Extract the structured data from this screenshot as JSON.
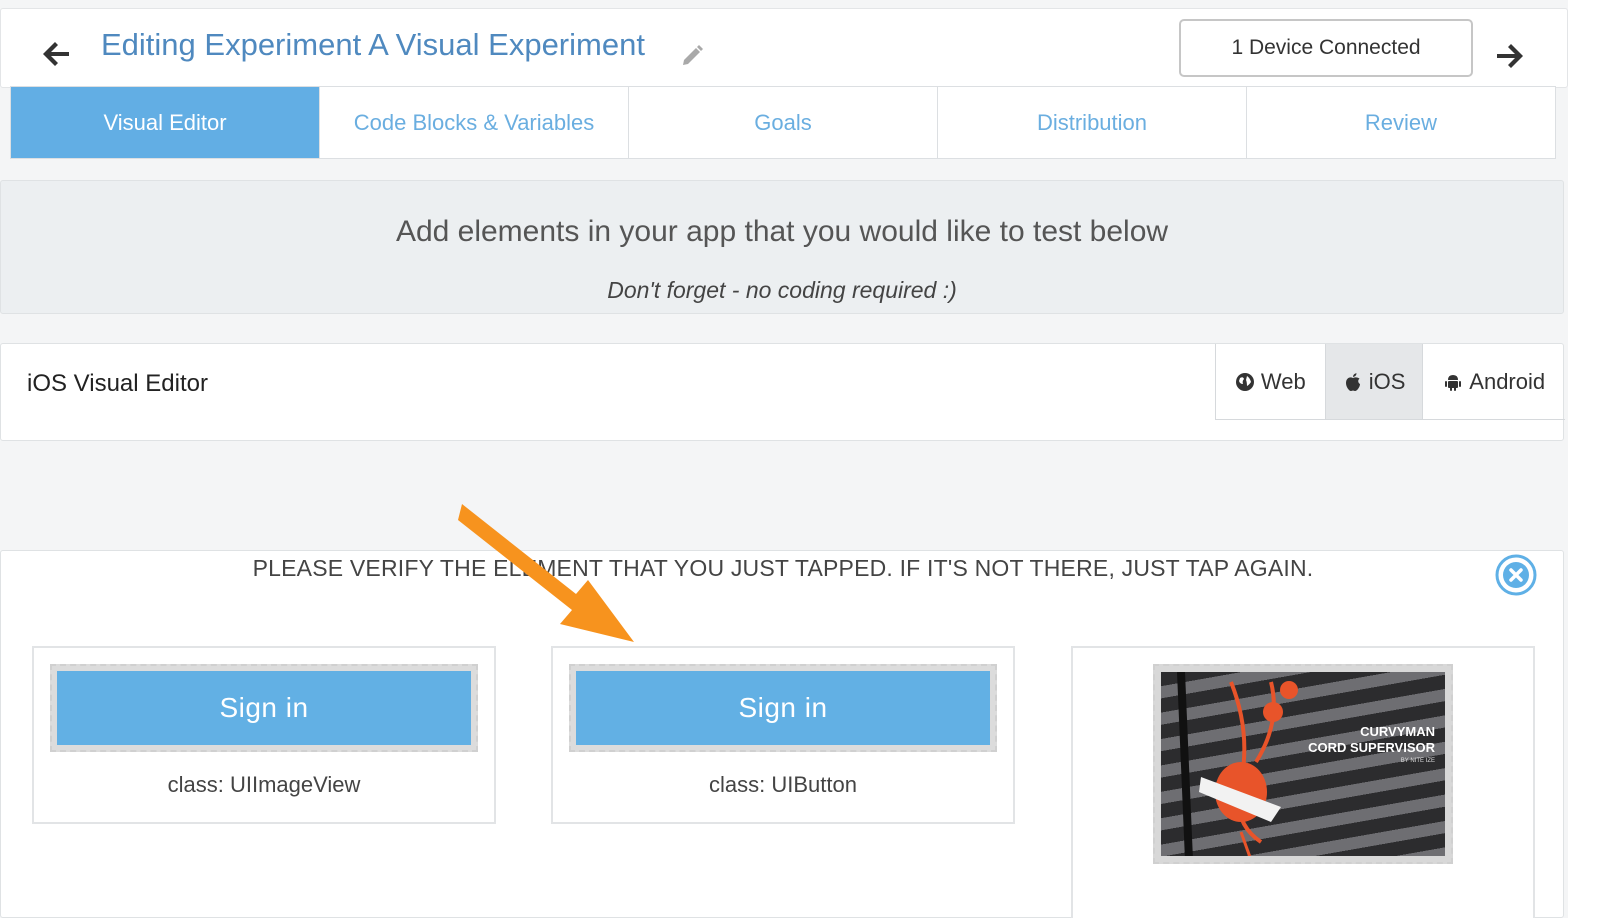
{
  "header": {
    "title": "Editing Experiment A Visual Experiment",
    "device_status": "1 Device Connected"
  },
  "tabs": [
    {
      "label": "Visual Editor",
      "active": true
    },
    {
      "label": "Code Blocks & Variables",
      "active": false
    },
    {
      "label": "Goals",
      "active": false
    },
    {
      "label": "Distribution",
      "active": false
    },
    {
      "label": "Review",
      "active": false
    }
  ],
  "banner": {
    "title": "Add elements in your app that you would like to test below",
    "subtitle": "Don't forget - no coding required :)"
  },
  "editor": {
    "title": "iOS Visual Editor",
    "platforms": [
      {
        "label": "Web",
        "icon": "globe-icon",
        "active": false
      },
      {
        "label": "iOS",
        "icon": "apple-icon",
        "active": true
      },
      {
        "label": "Android",
        "icon": "android-icon",
        "active": false
      }
    ]
  },
  "verify": {
    "message": "PLEASE VERIFY THE ELEMENT THAT YOU JUST TAPPED. IF IT'S NOT THERE, JUST TAP AGAIN.",
    "cards": [
      {
        "preview_text": "Sign in",
        "class_label": "class: UIImageView"
      },
      {
        "preview_text": "Sign in",
        "class_label": "class: UIButton"
      },
      {
        "product_line1": "CURVYMAN",
        "product_line2": "CORD SUPERVISOR",
        "product_line3": "BY NITE IZE"
      }
    ]
  },
  "colors": {
    "accent": "#62aee4",
    "title": "#4f89bf",
    "arrow": "#f7931e"
  }
}
